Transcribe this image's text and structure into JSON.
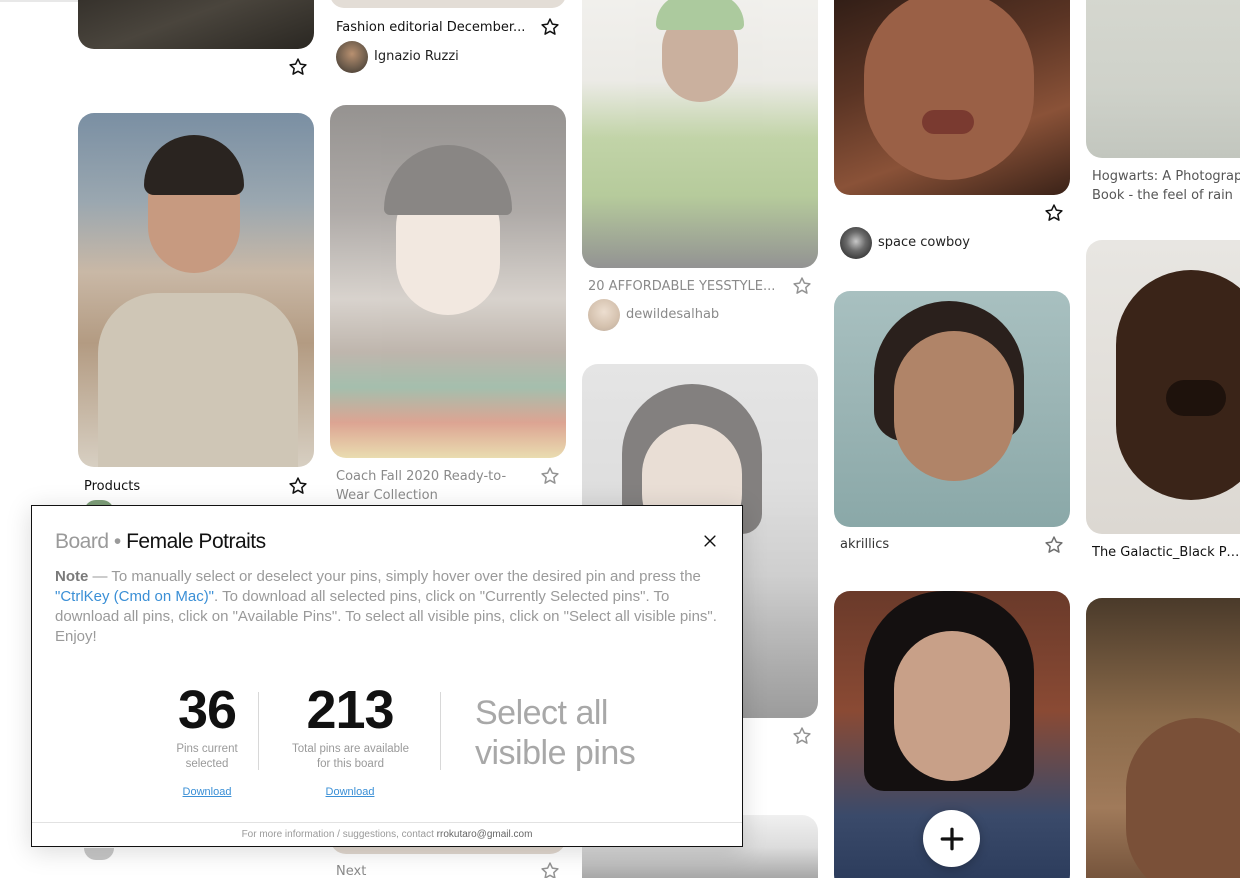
{
  "pins": [
    {
      "id": "pin-a",
      "title": "",
      "user": "",
      "starred": false
    },
    {
      "id": "pin-b",
      "title": "Fashion editorial December...",
      "user": "Ignazio Ruzzi"
    },
    {
      "id": "pin-c",
      "title": "20 AFFORDABLE YESSTYLE...",
      "user": "dewildesalhab"
    },
    {
      "id": "pin-d",
      "title": "",
      "user": "space cowboy"
    },
    {
      "id": "pin-e",
      "title": "Hogwarts: A Photograp Book - the feel of rain",
      "user": ""
    },
    {
      "id": "pin-f",
      "title": "Products",
      "user": ""
    },
    {
      "id": "pin-g",
      "title": "Coach Fall 2020 Ready-to-Wear Collection",
      "user": ""
    },
    {
      "id": "pin-h",
      "title": "",
      "user": ""
    },
    {
      "id": "pin-i",
      "title": "",
      "user": "akrillics"
    },
    {
      "id": "pin-j",
      "title": "The Galactic_Black Princ",
      "user": ""
    },
    {
      "id": "pin-k",
      "title": "",
      "user": ""
    },
    {
      "id": "pin-l",
      "title": "",
      "user": ""
    },
    {
      "id": "pin-m",
      "title": "Next",
      "user": ""
    }
  ],
  "modal": {
    "title_prefix": "Board",
    "title_separator": " • ",
    "title_board": "Female Potraits",
    "note_label": "Note",
    "note_part1": " — To manually select or deselect your pins, simply hover over the desired pin and press the ",
    "note_key": "\"CtrlKey (Cmd on Mac)\"",
    "note_part2": ". To download all selected pins, click on \"Currently Selected pins\". To download all pins, click on \"Available Pins\". To select all visible pins, click on \"Select all visible pins\". Enjoy!",
    "selected_count": "36",
    "selected_caption": "Pins current selected",
    "selected_download": "Download",
    "total_count": "213",
    "total_caption": "Total pins are available for this board",
    "total_download": "Download",
    "select_all_label": "Select all visible pins",
    "footer_text": "For more information / suggestions, contact ",
    "footer_email": "rrokutaro@gmail.com"
  },
  "colors": {
    "accent_link": "#3a8fd6",
    "muted_text": "#9a9a9a"
  }
}
